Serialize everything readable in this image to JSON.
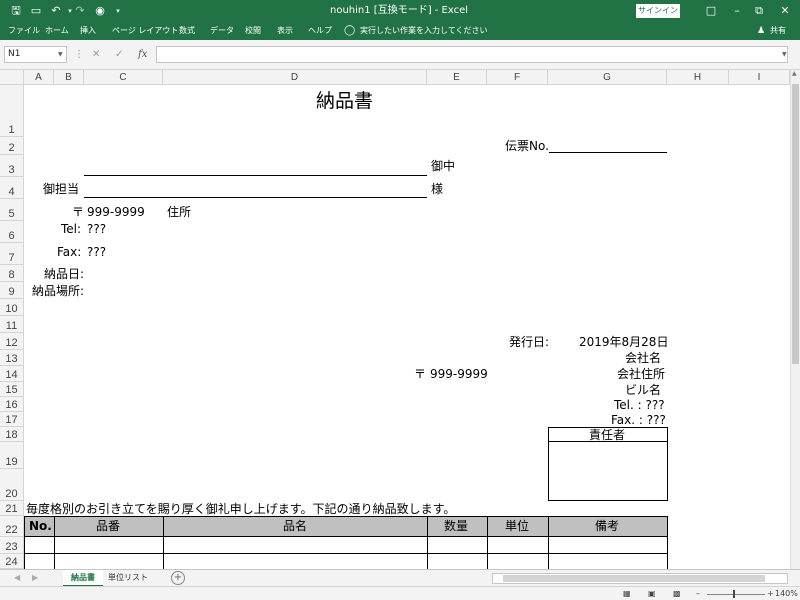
{
  "window": {
    "title": "nouhin1 [互換モード] - Excel",
    "signin_label": "サインイン"
  },
  "menu": {
    "items": [
      "ファイル",
      "ホーム",
      "挿入",
      "ページ レイアウト",
      "数式",
      "データ",
      "校閲",
      "表示",
      "ヘルプ"
    ],
    "tell_me": "実行したい作業を入力してください",
    "share": "共有"
  },
  "formula_bar": {
    "name_box": "N1",
    "fx": "fx",
    "value": ""
  },
  "columns": [
    "A",
    "B",
    "C",
    "D",
    "E",
    "F",
    "G",
    "H",
    "I"
  ],
  "rows": [
    "1",
    "2",
    "3",
    "4",
    "5",
    "6",
    "7",
    "8",
    "9",
    "10",
    "11",
    "12",
    "13",
    "14",
    "15",
    "16",
    "17",
    "18",
    "19",
    "20",
    "21",
    "22",
    "23",
    "24"
  ],
  "sheet": {
    "title": "納品書",
    "slip_no_label": "伝票No.",
    "onchu": "御中",
    "tantou_label": "御担当",
    "sama": "様",
    "postal_mark": "〒",
    "postal_code": "999-9999",
    "address_label": "住所",
    "tel_label": "Tel:",
    "tel_value": "???",
    "fax_label": "Fax:",
    "fax_value": "???",
    "delivery_date_label": "納品日:",
    "delivery_place_label": "納品場所:",
    "issue_date_label": "発行日:",
    "issue_date_value": "2019年8月28日",
    "company_name": "会社名",
    "company_postal_mark": "〒",
    "company_postal_code": "999-9999",
    "company_address": "会社住所",
    "building_name": "ビル名",
    "company_tel": "Tel. : ???",
    "company_fax": "Fax. : ???",
    "responsible_label": "責任者",
    "greeting": "毎度格別のお引き立てを賜り厚く御礼申し上げます。下記の通り納品致します。",
    "table_headers": [
      "No.",
      "品番",
      "品名",
      "数量",
      "単位",
      "備考"
    ]
  },
  "sheet_tabs": {
    "tabs": [
      "納品書",
      "単位リスト"
    ],
    "add_label": "+"
  },
  "status": {
    "zoom": "140%"
  }
}
